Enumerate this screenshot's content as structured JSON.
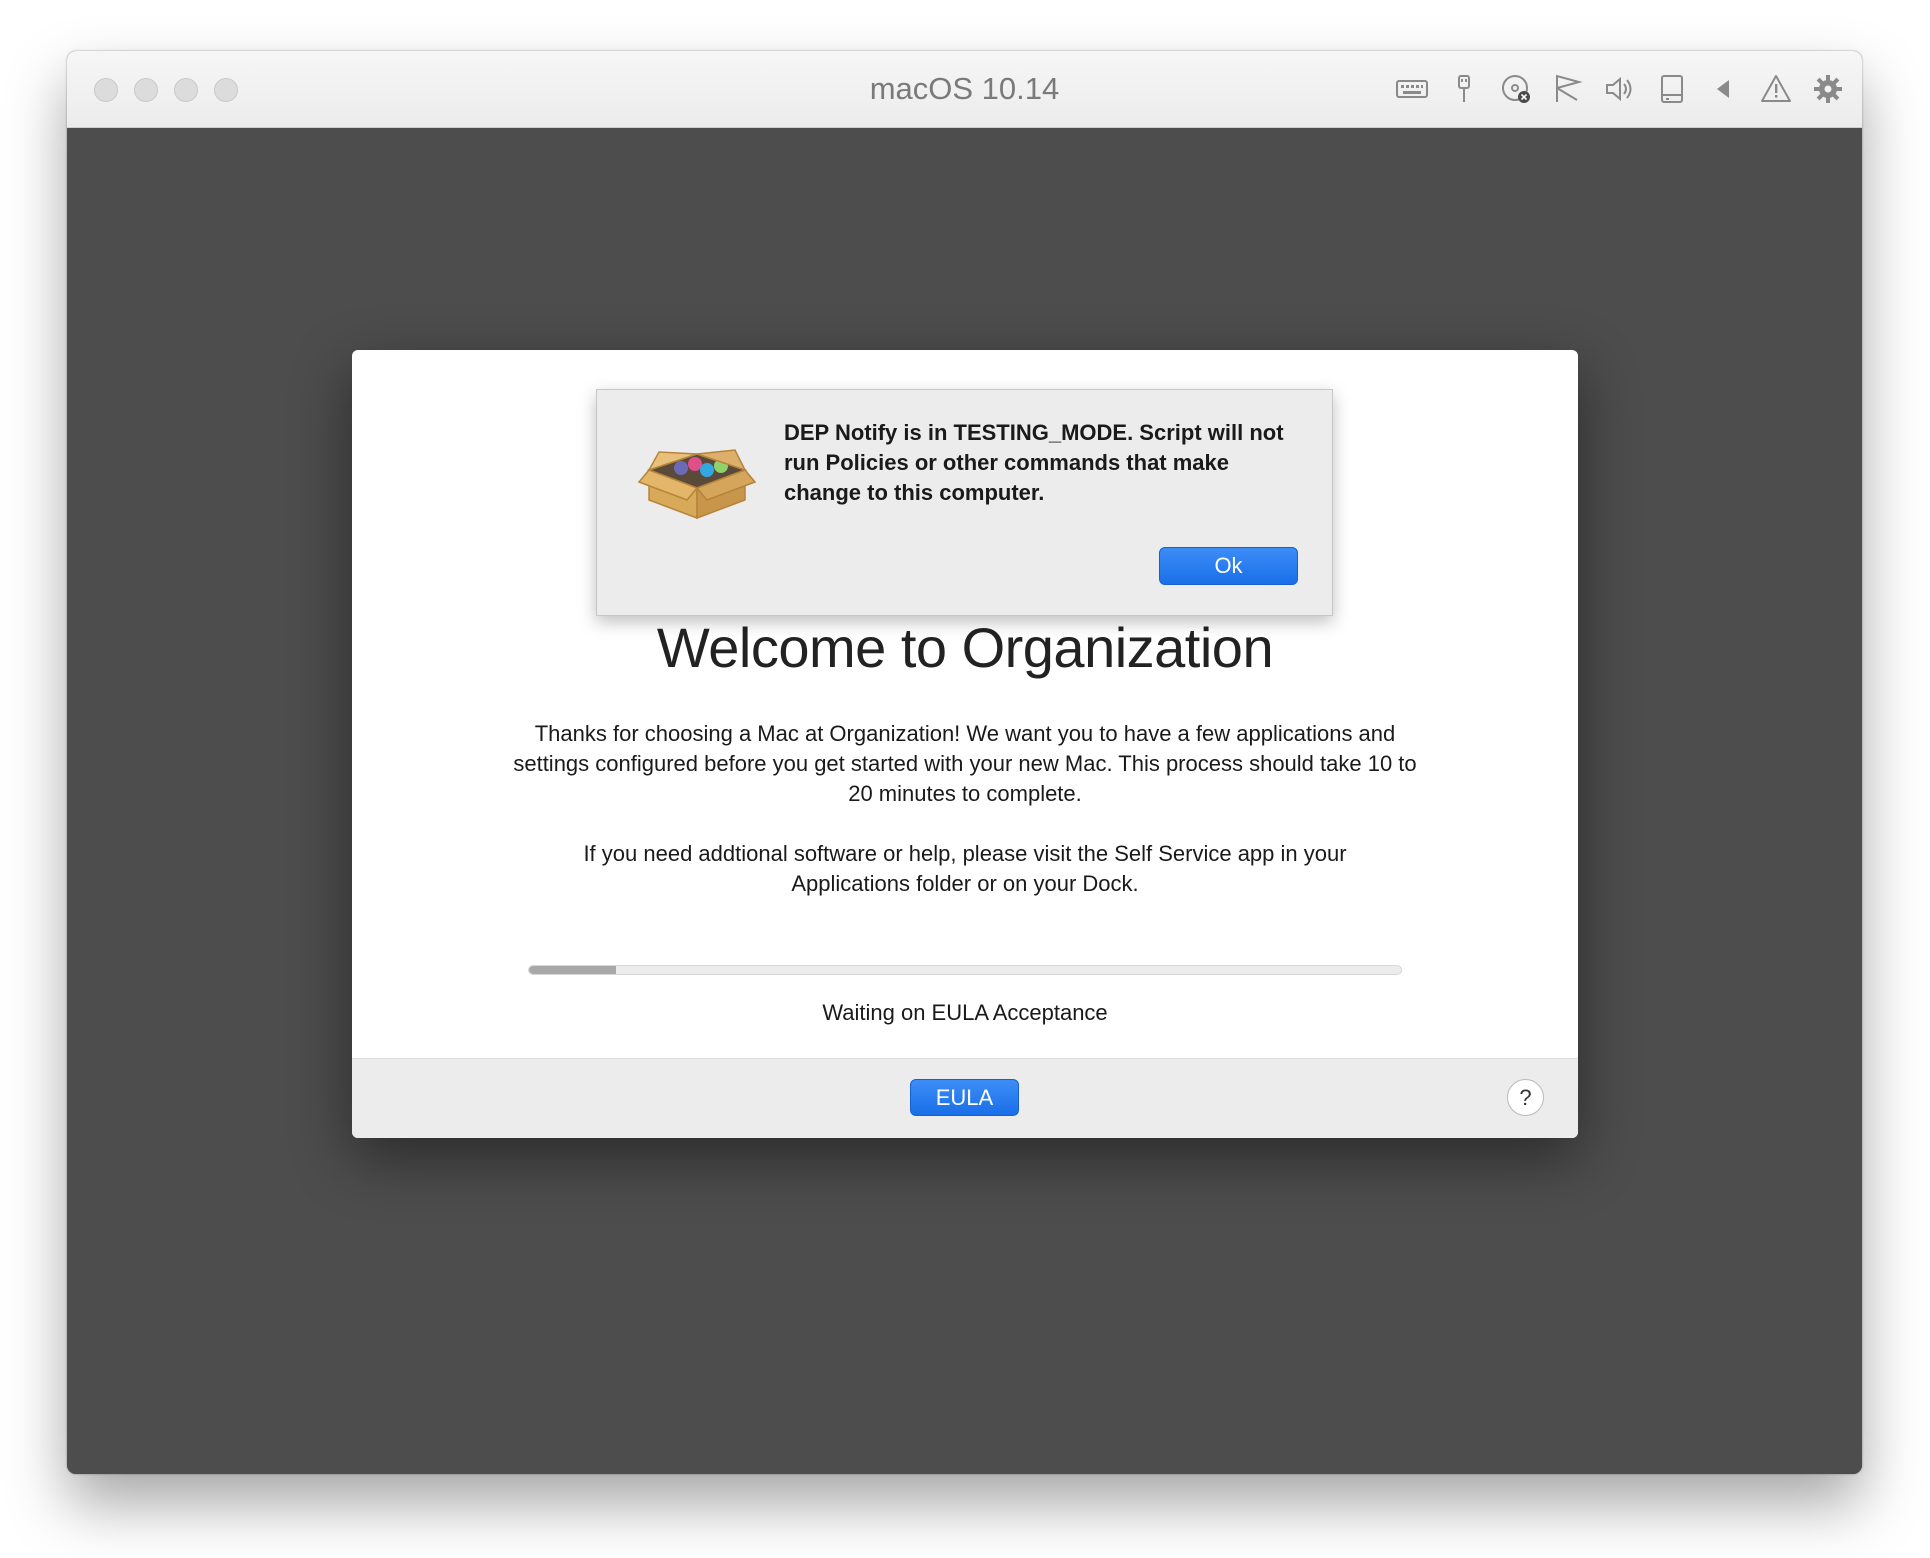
{
  "window": {
    "title": "macOS 10.14"
  },
  "toolbar": {
    "icons": [
      "keyboard-icon",
      "usb-icon",
      "cd-rom-icon",
      "network-icon",
      "sound-icon",
      "hard-disk-icon",
      "back-icon",
      "warning-icon",
      "gear-icon"
    ]
  },
  "dep_notify": {
    "welcome_title": "Welcome to Organization",
    "paragraph_1": "Thanks for choosing a Mac at Organization! We want you to have a few applications and settings configured before you get started with your new Mac. This process should take 10 to 20 minutes to complete.",
    "paragraph_2": "If you need addtional software or help, please visit the Self Service app in your Applications folder or on your Dock.",
    "progress_percent": 10,
    "status_text": "Waiting on EULA Acceptance",
    "eula_label": "EULA",
    "help_label": "?"
  },
  "alert": {
    "message": "DEP Notify is in TESTING_MODE. Script will not run Policies or other commands that make change to this computer.",
    "ok_label": "Ok"
  },
  "colors": {
    "accent_blue": "#1a6fe8",
    "vm_background": "#4d4d4d"
  }
}
